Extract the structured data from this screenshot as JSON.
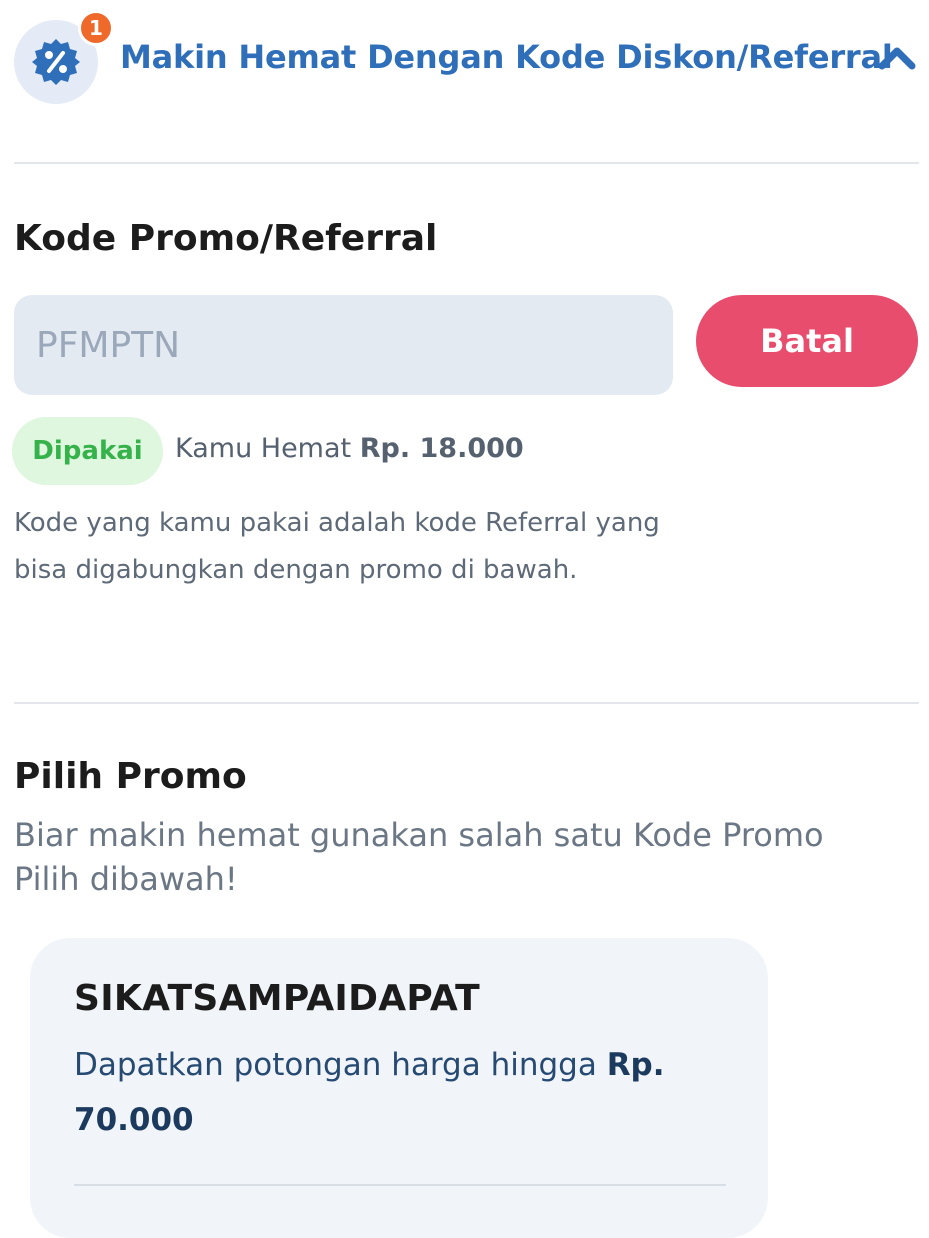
{
  "header": {
    "title": "Makin Hemat Dengan Kode Diskon/Referral",
    "badge_count": "1",
    "icon": "discount-badge-icon",
    "toggle_icon": "chevron-up-icon"
  },
  "kode_section": {
    "title": "Kode Promo/Referral",
    "input_value": "PFMPTN",
    "cancel_label": "Batal",
    "status_label": "Dipakai",
    "savings_prefix": "Kamu Hemat",
    "savings_amount": "Rp. 18.000",
    "note": "Kode yang kamu pakai adalah kode Referral yang bisa digabungkan dengan promo di bawah."
  },
  "pilih_section": {
    "title": "Pilih Promo",
    "description": "Biar makin hemat gunakan salah satu Kode Promo Pilih dibawah!"
  },
  "promos": [
    {
      "code": "SIKATSAMPAIDAPAT",
      "desc_prefix": "Dapatkan potongan harga hingga",
      "desc_amount": "Rp. 70.000"
    }
  ],
  "colors": {
    "accent_blue": "#2f6fba",
    "cancel_red": "#e84d6d",
    "badge_orange": "#ef6a2a",
    "success_green": "#36b24a"
  }
}
